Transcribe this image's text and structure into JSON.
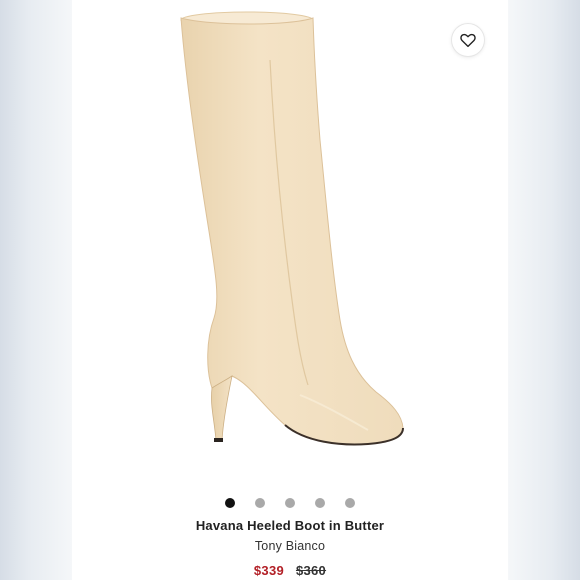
{
  "product": {
    "name": "Havana Heeled Boot in Butter",
    "brand": "Tony Bianco",
    "sale_price": "$339",
    "original_price": "$360",
    "image_color": "#f1dfc0"
  },
  "carousel": {
    "dot_count": 5,
    "active_index": 0
  },
  "colors": {
    "sale_price": "#b21f26",
    "dot_active": "#111111",
    "dot_inactive": "#a9a9a9"
  },
  "icons": {
    "favorite": "heart-icon"
  }
}
